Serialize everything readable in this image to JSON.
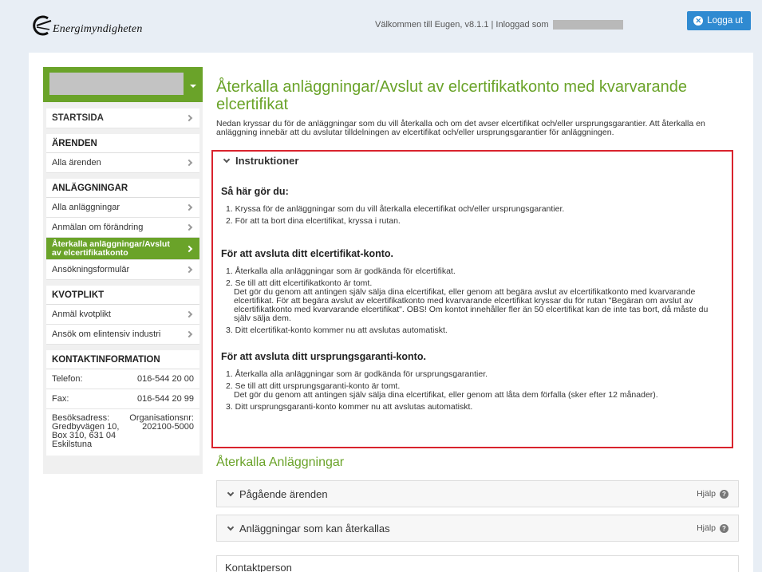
{
  "header": {
    "logo_text": "Energimyndigheten",
    "welcome_text": "Välkommen till Eugen, v8.1.1 | Inloggad som",
    "logout_label": "Logga ut"
  },
  "sidebar": {
    "startsida": "STARTSIDA",
    "arenden_head": "ÄRENDEN",
    "arenden_items": [
      "Alla ärenden"
    ],
    "anlaggningar_head": "ANLÄGGNINGAR",
    "anlaggningar_items": [
      "Alla anläggningar",
      "Anmälan om förändring",
      "Återkalla anläggningar/Avslut av elcertifikatkonto",
      "Ansökningsformulär"
    ],
    "kvotplikt_head": "KVOTPLIKT",
    "kvotplikt_items": [
      "Anmäl kvotplikt",
      "Ansök om elintensiv industri"
    ],
    "kontakt_head": "KONTAKTINFORMATION",
    "telefon_label": "Telefon:",
    "telefon_value": "016-544 20 00",
    "fax_label": "Fax:",
    "fax_value": "016-544 20 99",
    "adress_label": "Besöksadress:",
    "adress_value": "Gredbyvägen 10, Box 310, 631 04 Eskilstuna",
    "orgnr_label": "Organisationsnr:",
    "orgnr_value": "202100-5000"
  },
  "main": {
    "title": "Återkalla anläggningar/Avslut av elcertifikatkonto med kvarvarande elcertifikat",
    "intro": "Nedan kryssar du för de anläggningar som du vill återkalla och om det avser elcertifikat och/eller ursprungsgarantier. Att återkalla en anläggning innebär att du avslutar tilldelningen av elcertifikat och/eller ursprungsgarantier för anläggningen.",
    "instr_toggle": "Instruktioner",
    "h1": "Så här gör du:",
    "list1": [
      "1. Kryssa för de anläggningar som du vill återkalla elecertifikat och/eller ursprungsgarantier.",
      "2. För att ta bort dina elcertifikat, kryssa i rutan."
    ],
    "h2": "För att avsluta ditt elcertifikat-konto.",
    "list2_1": "1. Återkalla alla anläggningar som är godkända för elcertifikat.",
    "list2_2": "2. Se till att ditt elcertifikatkonto är tomt.",
    "list2_2_sub": "Det gör du genom att antingen själv sälja dina elcertifikat, eller genom att begära avslut av elcertifikatkonto med kvarvarande elcertifikat. För att begära avslut av elcertifikatkonto med kvarvarande elcertifikat kryssar du för rutan \"Begäran om avslut av elcertifikatkonto med kvarvarande elcertifikat\". OBS! Om kontot innehåller fler än 50 elcertifikat kan de inte tas bort, då måste du själv sälja dem.",
    "list2_3": "3. Ditt elcertifikat-konto kommer nu att avslutas automatiskt.",
    "h3": "För att avsluta ditt ursprungsgaranti-konto.",
    "list3_1": "1. Återkalla alla anläggningar som är godkända för ursprungsgarantier.",
    "list3_2": "2. Se till att ditt ursprungsgaranti-konto är tomt.",
    "list3_2_sub": "Det gör du genom att antingen själv sälja dina elcertifikat, eller genom att låta dem förfalla (sker efter 12 månader).",
    "list3_3": "3. Ditt ursprungsgaranti-konto kommer nu att avslutas automatiskt.",
    "section_title": "Återkalla Anläggningar",
    "panel1": "Pågående ärenden",
    "panel2": "Anläggningar som kan återkallas",
    "help_label": "Hjälp",
    "panel3": "Kontaktperson"
  },
  "colors": {
    "accent_green": "#6aa329",
    "button_blue": "#2f8ad1",
    "highlight_red": "#d9232d"
  }
}
